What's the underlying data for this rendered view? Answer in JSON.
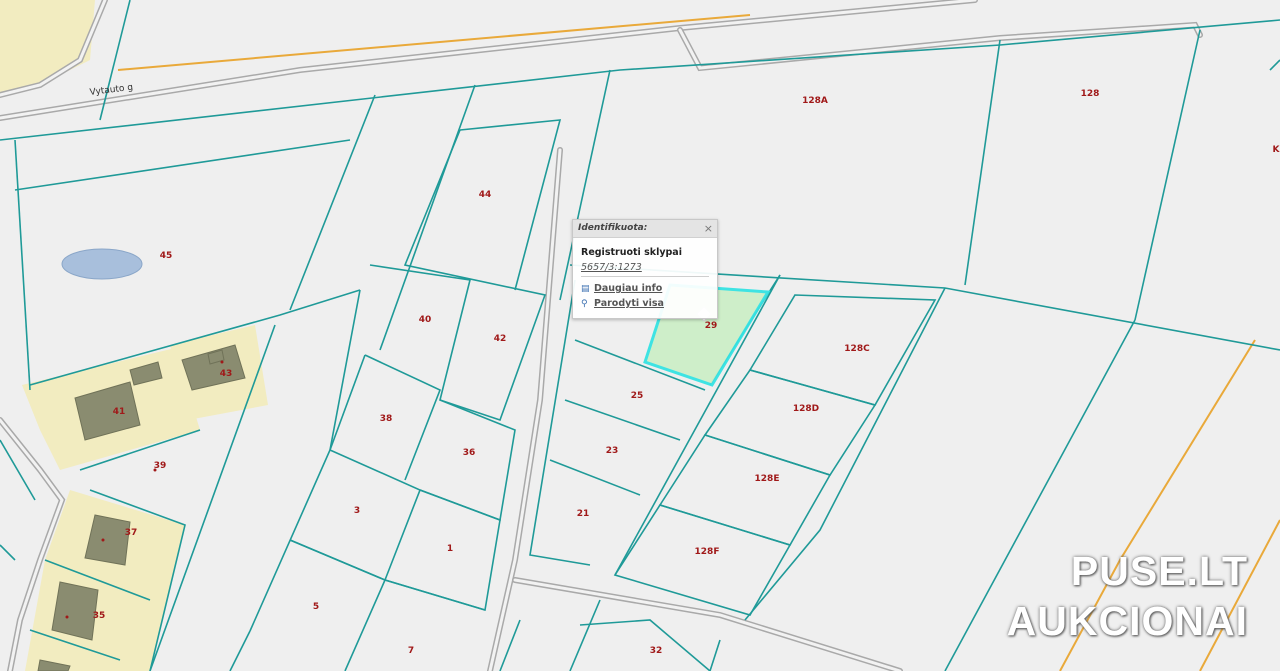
{
  "street_name": "Vytauto g",
  "parcel_labels": {
    "p128A": "128A",
    "p128": "128",
    "pK": "K",
    "p44": "44",
    "p45": "45",
    "p40": "40",
    "p42": "42",
    "p29": "29",
    "p128C": "128C",
    "p38": "38",
    "p36": "36",
    "p25": "25",
    "p128D": "128D",
    "p41": "41",
    "p43": "43",
    "p39": "39",
    "p23": "23",
    "p128E": "128E",
    "p3": "3",
    "p1": "1",
    "p21": "21",
    "p37": "37",
    "p128F": "128F",
    "p35": "35",
    "p5": "5",
    "p7": "7",
    "p32": "32"
  },
  "popup": {
    "title": "Identifikuota:",
    "close": "×",
    "layer": "Registruoti sklypai",
    "code": "5657/3:1273",
    "more_info": "Daugiau info",
    "show_all": "Parodyti visa",
    "more_icon": "document-icon",
    "show_icon": "magnifier-icon"
  },
  "watermark": {
    "line1": "PUSE.LT",
    "line2": "AUKCIONAI"
  },
  "colors": {
    "parcel_line": "#1f9a98",
    "selected_fill": "#cdeec8",
    "selected_outline": "#35e3e3",
    "label": "#a01919",
    "yard": "#f2ecc0"
  }
}
